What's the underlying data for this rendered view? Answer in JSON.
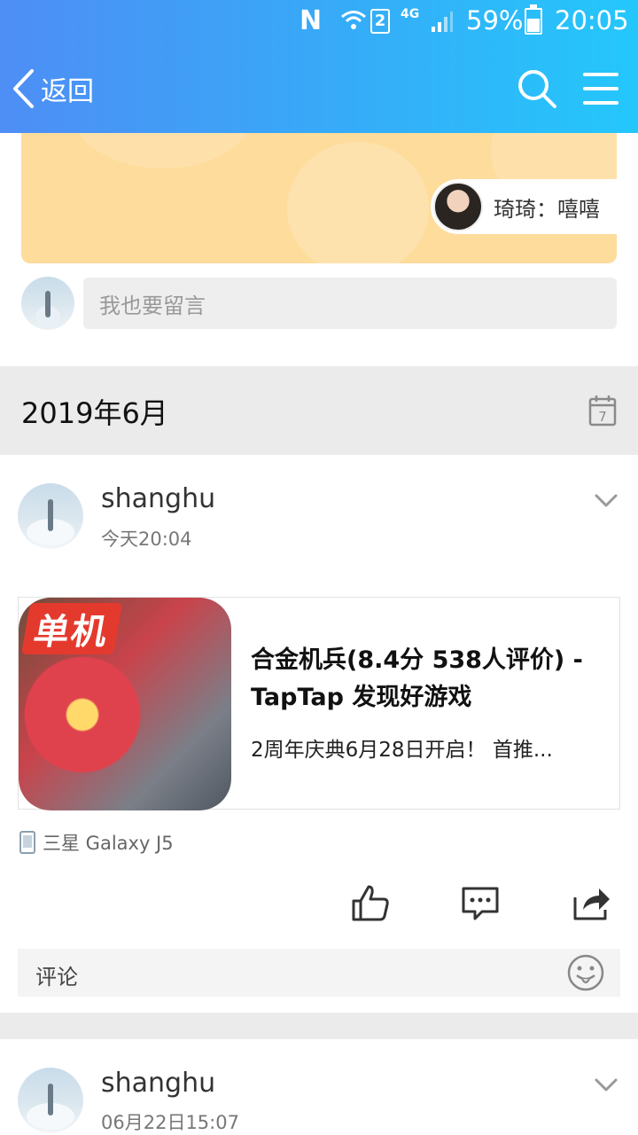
{
  "status_bar": {
    "sim_slot": "2",
    "network": "4G",
    "battery_percent": "59%",
    "battery_level": 0.59,
    "time": "20:05"
  },
  "nav": {
    "back_label": "返回",
    "icons": [
      "back-chevron-icon",
      "search-icon",
      "menu-icon"
    ]
  },
  "message_banner": {
    "message": "琦琦：嘻嘻"
  },
  "comment_box": {
    "placeholder": "我也要留言"
  },
  "month_section": {
    "label": "2019年6月",
    "calendar_day": "7"
  },
  "posts": [
    {
      "author": "shanghu",
      "time": "今天20:04",
      "link": {
        "badge": "单机",
        "title": "合金机兵(8.4分 538人评价) - TapTap 发现好游戏",
        "description": "2周年庆典6月28日开启！ 首推..."
      },
      "device": "三星 Galaxy J5",
      "actions": [
        "like-icon",
        "comment-icon",
        "share-icon"
      ],
      "comments_label": "评论"
    },
    {
      "author": "shanghu",
      "time": "06月22日15:07"
    }
  ],
  "colors": {
    "header_start": "#4e8ef5",
    "header_end": "#24c7fb",
    "banner": "#fedc9c",
    "section_bg": "#ebebeb"
  }
}
